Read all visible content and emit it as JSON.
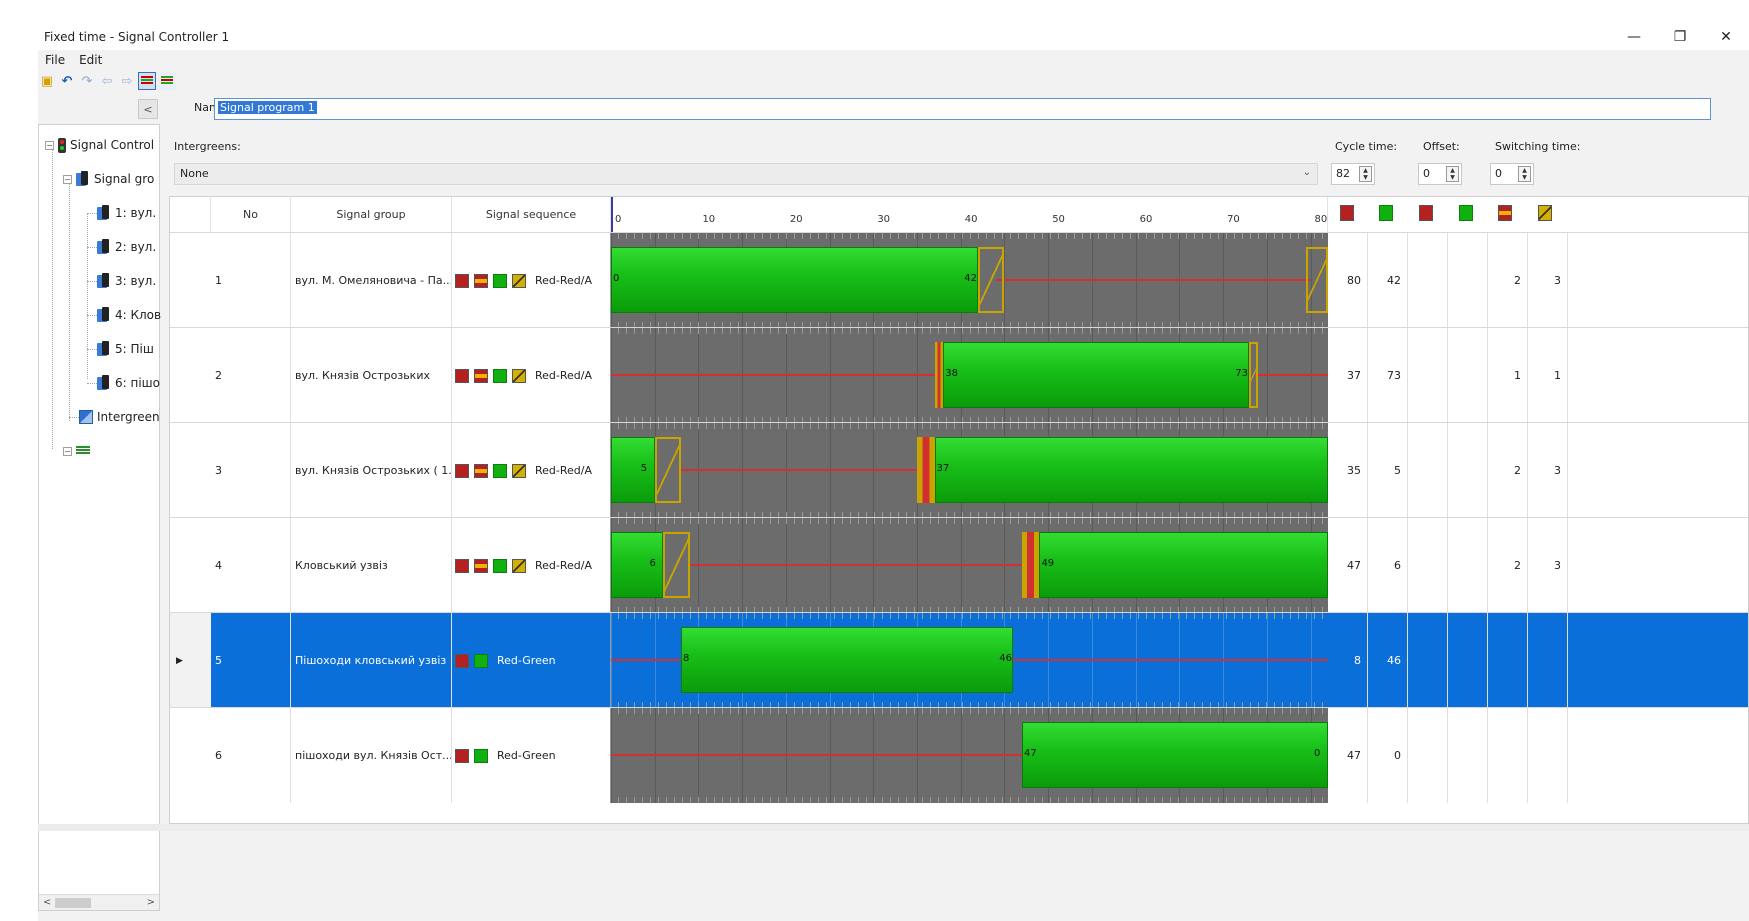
{
  "window": {
    "title": "Fixed time - Signal Controller 1",
    "controls": {
      "minimize": "—",
      "maximize": "❐",
      "close": "✕"
    }
  },
  "menu": {
    "items": [
      "File",
      "Edit"
    ]
  },
  "toolbar": {
    "buttons": [
      "open-icon",
      "undo-icon",
      "redo-icon",
      "back-icon",
      "forward-icon",
      "gantt-view-icon",
      "list-view-icon"
    ]
  },
  "tree": {
    "collapse_label": "<",
    "root": "Signal Control",
    "group": "Signal gro",
    "items": [
      "1: вул.",
      "2: вул.",
      "3: вул.",
      "4: Клов",
      "5: Піш",
      "6: пішо"
    ],
    "intergreen": "Intergreen"
  },
  "form": {
    "name_label": "Name:",
    "name_value": "Signal program 1",
    "intergreens_label": "Intergreens:",
    "intergreens_value": "None",
    "cycle_label": "Cycle time:",
    "cycle_value": "82",
    "offset_label": "Offset:",
    "offset_value": "0",
    "switching_label": "Switching time:",
    "switching_value": "0"
  },
  "grid": {
    "headers": {
      "no": "No",
      "signal_group": "Signal group",
      "signal_sequence": "Signal sequence"
    },
    "axis_ticks": [
      "0",
      "10",
      "20",
      "30",
      "40",
      "50",
      "60",
      "70",
      "80"
    ],
    "rows": [
      {
        "no": "1",
        "name": "вул. М. Омеляновича - Па...",
        "seq_icons": [
          "red",
          "redamber",
          "green",
          "amber"
        ],
        "seq": "Red-Red/A",
        "red_end": "80",
        "green_end": "42",
        "c3": "",
        "c4": "",
        "c5": "2",
        "c6": "3",
        "labels": [
          "0",
          "42"
        ]
      },
      {
        "no": "2",
        "name": "вул. Князів Острозьких",
        "seq_icons": [
          "red",
          "redamber",
          "green",
          "amber"
        ],
        "seq": "Red-Red/A",
        "red_end": "37",
        "green_end": "73",
        "c3": "",
        "c4": "",
        "c5": "1",
        "c6": "1",
        "labels": [
          "38",
          "73"
        ]
      },
      {
        "no": "3",
        "name": "вул. Князів Острозьких ( 1...",
        "seq_icons": [
          "red",
          "redamber",
          "green",
          "amber"
        ],
        "seq": "Red-Red/A",
        "red_end": "35",
        "green_end": "5",
        "c3": "",
        "c4": "",
        "c5": "2",
        "c6": "3",
        "labels": [
          "5",
          "37"
        ]
      },
      {
        "no": "4",
        "name": "Кловський узвіз",
        "seq_icons": [
          "red",
          "redamber",
          "green",
          "amber"
        ],
        "seq": "Red-Red/A",
        "red_end": "47",
        "green_end": "6",
        "c3": "",
        "c4": "",
        "c5": "2",
        "c6": "3",
        "labels": [
          "6",
          "49"
        ]
      },
      {
        "no": "5",
        "name": "Пішоходи кловський узвіз",
        "seq_icons": [
          "red",
          "green"
        ],
        "seq": "Red-Green",
        "red_end": "8",
        "green_end": "46",
        "c3": "",
        "c4": "",
        "c5": "",
        "c6": "",
        "labels": [
          "8",
          "46"
        ],
        "selected": true
      },
      {
        "no": "6",
        "name": "пішоходи вул. Князів Ост...",
        "seq_icons": [
          "red",
          "green"
        ],
        "seq": "Red-Green",
        "red_end": "47",
        "green_end": "0",
        "c3": "",
        "c4": "",
        "c5": "",
        "c6": "",
        "labels": [
          "47",
          "0"
        ]
      }
    ]
  },
  "colors": {
    "selection": "#0a6fd8",
    "green": "#19c019",
    "red": "#d23030",
    "amber": "#c9a400",
    "timeline_bg": "#6c6c6c"
  }
}
